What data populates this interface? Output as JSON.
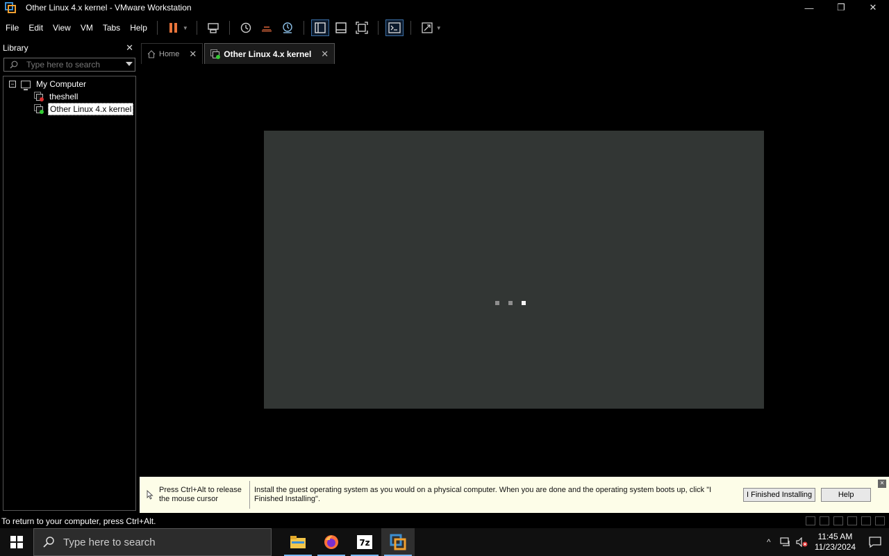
{
  "window": {
    "title": "Other Linux 4.x kernel - VMware Workstation",
    "minimize": "—",
    "restore": "❐",
    "close": "✕"
  },
  "menu": [
    "File",
    "Edit",
    "View",
    "VM",
    "Tabs",
    "Help"
  ],
  "toolbar": {
    "icons": [
      "pause-icon",
      "send-ctrl-alt-del-icon",
      "snapshot-icon",
      "revert-snapshot-icon",
      "snapshot-manager-icon",
      "show-library-icon",
      "thumbnail-bar-icon",
      "full-screen-icon",
      "console-view-icon",
      "stretch-guest-icon"
    ]
  },
  "library": {
    "title": "Library",
    "close": "✕",
    "search_placeholder": "Type here to search",
    "tree": {
      "root_label": "My Computer",
      "expander": "−",
      "vms": [
        {
          "label": "theshell",
          "state": "off"
        },
        {
          "label": "Other Linux 4.x kernel",
          "state": "running",
          "selected": true
        }
      ]
    }
  },
  "tabs": [
    {
      "label": "Home",
      "icon": "home-icon",
      "close": "✕"
    },
    {
      "label": "Other Linux 4.x kernel",
      "icon": "vm-icon",
      "close": "✕",
      "active": true
    }
  ],
  "infobar": {
    "release_text": "Press Ctrl+Alt to release the mouse cursor",
    "install_text": "Install the guest operating system as you would on a physical computer. When you are done and the operating system boots up, click \"I Finished Installing\".",
    "finished_button": "I Finished Installing",
    "help_button": "Help",
    "close": "×"
  },
  "statusbar": {
    "text": "To return to your computer, press Ctrl+Alt."
  },
  "taskbar": {
    "search_placeholder": "Type here to search",
    "apps": [
      "file-explorer-icon",
      "firefox-icon",
      "7zip-icon",
      "vmware-icon"
    ],
    "time": "11:45 AM",
    "date": "11/23/2024",
    "tray_chevron": "^"
  },
  "colors": {
    "accent": "#3d8fd1",
    "pause": "#e8743b",
    "infobar_bg": "#fdfde8",
    "vm_screen": "#323634"
  }
}
